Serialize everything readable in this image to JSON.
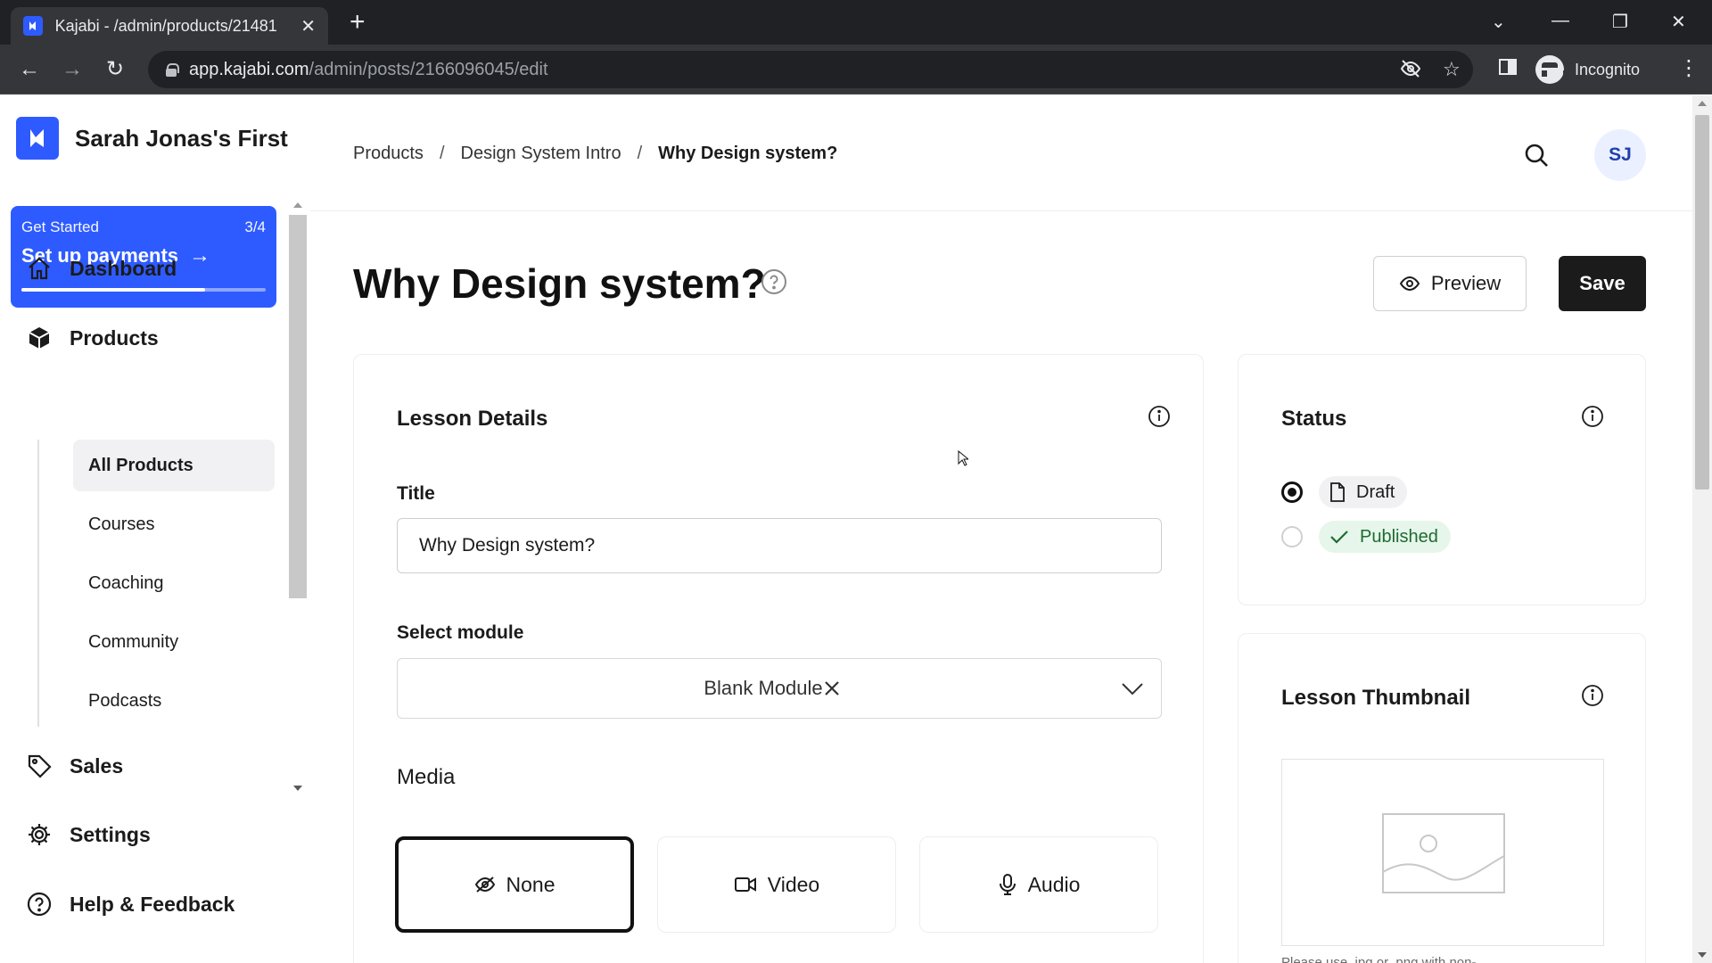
{
  "browser": {
    "tab_title": "Kajabi - /admin/products/21481",
    "tab_close": "✕",
    "new_tab": "+",
    "url_host": "app.kajabi.com",
    "url_path": "/admin/posts/2166096045/edit",
    "incognito_label": "Incognito",
    "icons": [
      "back-icon",
      "forward-icon",
      "reload-icon",
      "lock-icon",
      "eye-off-icon",
      "star-icon",
      "sidepanel-icon",
      "incognito-icon",
      "menu-icon"
    ]
  },
  "sidebar": {
    "brand_name": "Sarah Jonas's First",
    "get_started": {
      "label": "Get Started",
      "count": "3/4",
      "title": "Set up payments",
      "progress": 0.75
    },
    "nav": [
      {
        "label": "Dashboard",
        "icon": "home-icon"
      },
      {
        "label": "Products",
        "icon": "box-icon"
      },
      {
        "label": "Sales",
        "icon": "tag-icon"
      },
      {
        "label": "Settings",
        "icon": "gear-icon"
      },
      {
        "label": "Help & Feedback",
        "icon": "help-circle-icon"
      }
    ],
    "products_sub": [
      "All Products",
      "Courses",
      "Coaching",
      "Community",
      "Podcasts"
    ],
    "active_sub": "All Products"
  },
  "header": {
    "breadcrumb": [
      "Products",
      "Design System Intro",
      "Why Design system?"
    ],
    "avatar_initials": "SJ"
  },
  "page": {
    "title": "Why Design system?",
    "preview_label": "Preview",
    "save_label": "Save"
  },
  "lesson_details": {
    "heading": "Lesson Details",
    "title_label": "Title",
    "title_value": "Why Design system?",
    "module_label": "Select module",
    "module_value": "Blank Module",
    "media_label": "Media",
    "media_options": [
      "None",
      "Video",
      "Audio"
    ],
    "media_selected": "None"
  },
  "status": {
    "heading": "Status",
    "options": [
      "Draft",
      "Published"
    ],
    "selected": "Draft"
  },
  "thumbnail": {
    "heading": "Lesson Thumbnail",
    "hint": "Please use .jpg or .png with non-"
  },
  "colors": {
    "brand_blue": "#2e5bff",
    "save_bg": "#1b1b1b",
    "published_bg": "#e6f6ea",
    "published_text": "#1e6b33"
  }
}
